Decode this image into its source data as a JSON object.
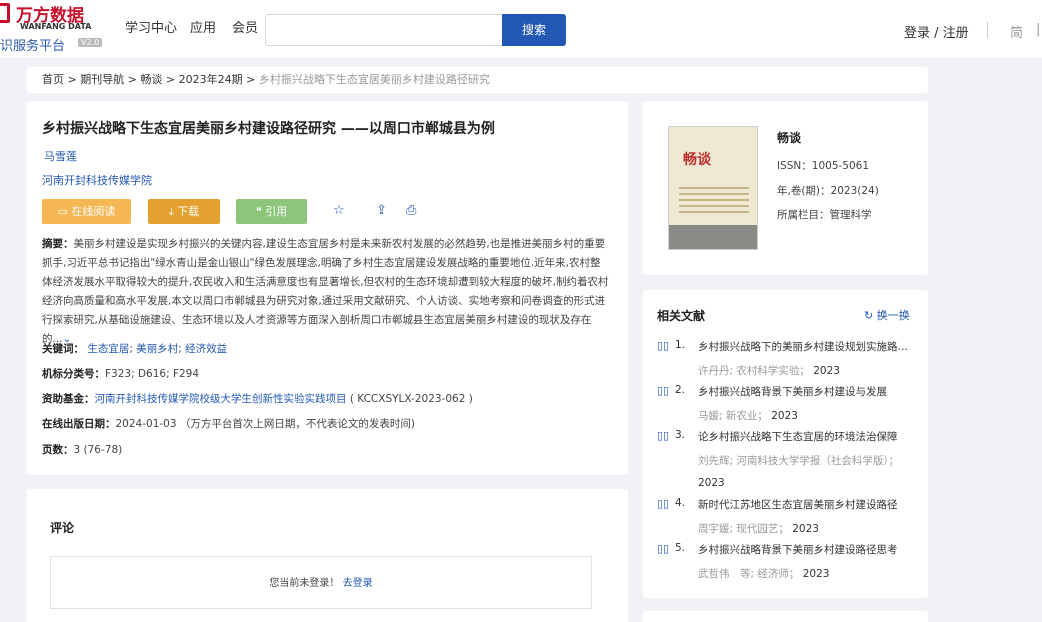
{
  "header": {
    "logo_cn": "万方数据",
    "logo_en": "WANFANG DATA",
    "logo_sub": "识服务平台",
    "version": "V2.0",
    "nav": [
      "学习中心",
      "应用",
      "会员"
    ],
    "search_button": "搜索",
    "search_placeholder": "",
    "login": "登录 / 注册",
    "lang": "简"
  },
  "breadcrumb": {
    "home": "首页",
    "items": [
      "期刊导航",
      "畅谈",
      "2023年24期"
    ],
    "current": "乡村振兴战略下生态宜居美丽乡村建设路径研究"
  },
  "article": {
    "title": "乡村振兴战略下生态宜居美丽乡村建设路径研究 ——以周口市郸城县为例",
    "author": "马雪莲",
    "organization": "河南开封科技传媒学院",
    "buttons": {
      "read": "在线阅读",
      "download": "下载",
      "cite": "引用"
    },
    "abstract_label": "摘要：",
    "abstract": "美丽乡村建设是实现乡村振兴的关键内容,建设生态宜居乡村是未来新农村发展的必然趋势,也是推进美丽乡村的重要抓手,习近平总书记指出\"绿水青山是金山银山\"绿色发展理念,明确了乡村生态宜居建设发展战略的重要地位.近年来,农村整体经济发展水平取得较大的提升,农民收入和生活满意度也有显著增长,但农村的生态环境却遭到较大程度的破坏,制约着农村经济向高质量和高水平发展,本文以周口市郸城县为研究对象,通过采用文献研究、个人访谈、实地考察和问卷调查的形式进行探索研究,从基础设施建设、生态环境以及人才资源等方面深入剖析周口市郸城县生态宜居美丽乡村建设的现状及存在的...",
    "keywords_label": "关键词：",
    "keywords": [
      "生态宜居",
      "美丽乡村",
      "经济效益"
    ],
    "class_label": "机标分类号：",
    "class_value": "F323; D616; F294",
    "fund_label": "资助基金：",
    "fund_link": "河南开封科技传媒学院校级大学生创新性实验实践项目",
    "fund_code": "( KCCXSYLX-2023-062 )",
    "date_label": "在线出版日期：",
    "date_value": "2024-01-03",
    "date_note": "（万方平台首次上网日期，不代表论文的发表时间)",
    "pages_label": "页数：",
    "pages_value": "3 (76-78)"
  },
  "comments": {
    "title": "评论",
    "not_logged": "您当前未登录！",
    "login_link": "去登录"
  },
  "journal": {
    "name": "畅谈",
    "issn": "ISSN：1005-5061",
    "volume": "年,卷(期)：2023(24)",
    "column": "所属栏目：管理科学",
    "cover_title": "畅谈"
  },
  "related": {
    "title": "相关文献",
    "refresh": "换一换",
    "items": [
      {
        "num": "1.",
        "title": "乡村振兴战略下的美丽乡村建设规划实施路径研究",
        "meta": "许丹丹;  农村科学实验；",
        "year": "2023"
      },
      {
        "num": "2.",
        "title": "乡村振兴战略背景下美丽乡村建设与发展",
        "meta": "马媛;  新农业；",
        "year": "2023"
      },
      {
        "num": "3.",
        "title": "论乡村振兴战略下生态宜居的环境法治保障",
        "meta": "刘先辉;  河南科技大学学报（社会科学版）；",
        "year": "2023"
      },
      {
        "num": "4.",
        "title": "新时代江苏地区生态宜居美丽乡村建设路径",
        "meta": "周宇媛;  现代园艺；",
        "year": "2023"
      },
      {
        "num": "5.",
        "title": "乡村振兴战略背景下美丽乡村建设路径思考",
        "meta": "武哲伟　等;  经济师；",
        "year": "2023"
      }
    ]
  }
}
